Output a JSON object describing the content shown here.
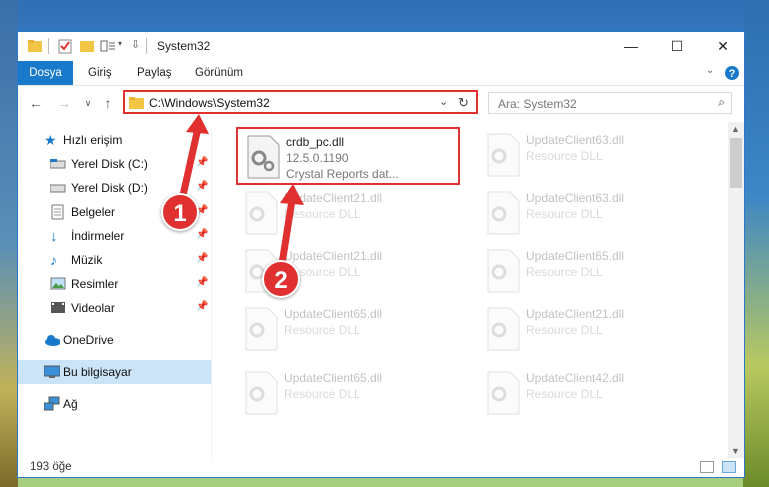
{
  "window": {
    "title": "System32",
    "controls": {
      "minimize": "—",
      "maximize": "☐",
      "close": "✕"
    }
  },
  "ribbon": {
    "tabs": [
      {
        "label": "Dosya",
        "active": true
      },
      {
        "label": "Giriş"
      },
      {
        "label": "Paylaş"
      },
      {
        "label": "Görünüm"
      }
    ]
  },
  "address": {
    "path": "C:\\Windows\\System32",
    "search_placeholder": "Ara: System32"
  },
  "sidebar": {
    "items": [
      {
        "label": "Hızlı erişim",
        "icon": "star-icon"
      },
      {
        "label": "Yerel Disk (C:)",
        "icon": "disk-icon",
        "pinned": true
      },
      {
        "label": "Yerel Disk (D:)",
        "icon": "disk-icon",
        "pinned": true
      },
      {
        "label": "Belgeler",
        "icon": "documents-icon",
        "pinned": true
      },
      {
        "label": "İndirmeler",
        "icon": "download-icon",
        "pinned": true
      },
      {
        "label": "Müzik",
        "icon": "music-icon",
        "pinned": true
      },
      {
        "label": "Resimler",
        "icon": "pictures-icon",
        "pinned": true
      },
      {
        "label": "Videolar",
        "icon": "videos-icon",
        "pinned": true
      },
      {
        "label": "OneDrive",
        "icon": "cloud-icon"
      },
      {
        "label": "Bu bilgisayar",
        "icon": "computer-icon",
        "selected": true
      },
      {
        "label": "Ağ",
        "icon": "network-icon"
      }
    ]
  },
  "files": [
    {
      "name": "crdb_pc.dll",
      "version": "12.5.0.1190",
      "desc": "Crystal Reports dat...",
      "highlight": true
    },
    {
      "name": "UpdateClient63.dll",
      "desc": "Resource DLL",
      "faded": true
    },
    {
      "name": "UpdateClient21.dll",
      "desc": "Resource DLL",
      "faded": true
    },
    {
      "name": "UpdateClient63.dll",
      "desc": "Resource DLL",
      "faded": true
    },
    {
      "name": "UpdateClient21.dll",
      "desc": "Resource DLL",
      "faded": true
    },
    {
      "name": "UpdateClient65.dll",
      "desc": "Resource DLL",
      "faded": true
    },
    {
      "name": "UpdateClient65.dll",
      "desc": "Resource DLL",
      "faded": true
    },
    {
      "name": "UpdateClient21.dll",
      "desc": "Resource DLL",
      "faded": true
    },
    {
      "name": "UpdateClient65.dll",
      "desc": "Resource DLL",
      "faded": true
    },
    {
      "name": "UpdateClient42.dll",
      "desc": "Resource DLL",
      "faded": true
    }
  ],
  "status": {
    "count": "193 öğe"
  },
  "annotations": {
    "badge1": "1",
    "badge2": "2",
    "color": "#e0302f"
  }
}
